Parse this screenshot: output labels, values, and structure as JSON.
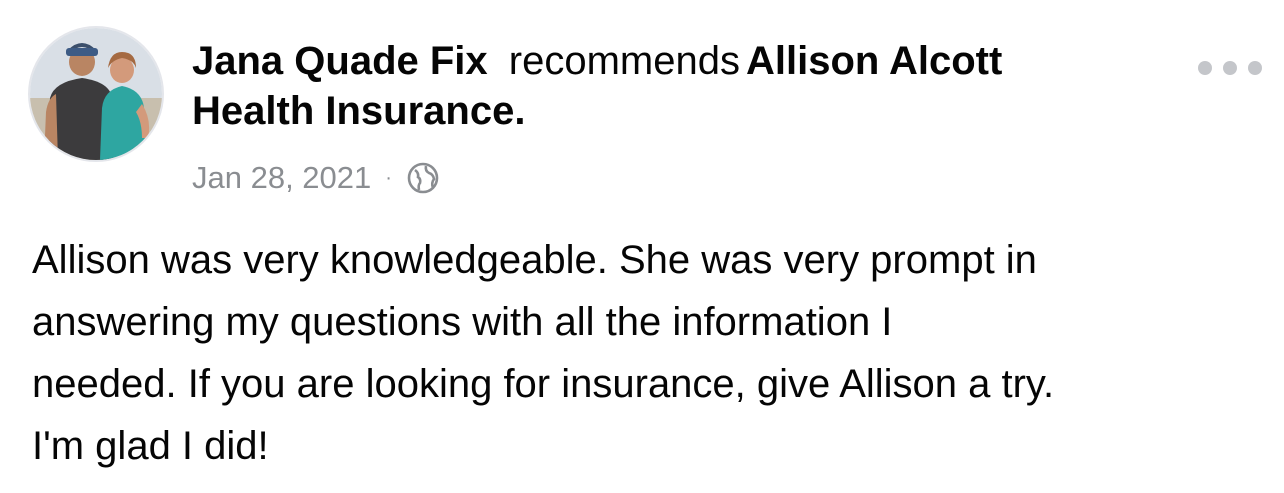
{
  "post": {
    "author": "Jana Quade Fix",
    "action": "recommends",
    "target_line1": "Allison Alcott",
    "target_line2": "Health Insurance.",
    "date": "Jan 28, 2021",
    "separator": "·",
    "privacy_icon": "globe-icon",
    "more_icon": "more-options-icon",
    "avatar_icon": "profile-photo",
    "text": "Allison was very knowledgeable.  She was very prompt in\nanswering my  questions with all the information I\nneeded. If you are looking for insurance, give Allison a try.\nI'm glad I did!"
  },
  "colors": {
    "text": "#050505",
    "meta": "#8a8d91",
    "more_dots": "#c4c6ca"
  }
}
